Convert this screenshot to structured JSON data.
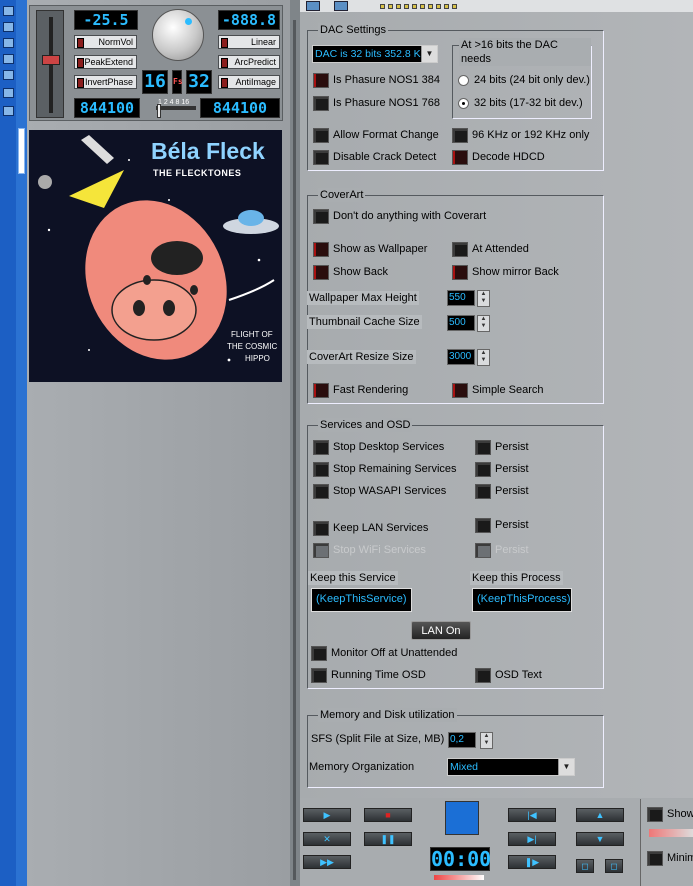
{
  "player": {
    "volume_display": "-25.5",
    "right_display": "-888.8",
    "norm_vol": "NormVol",
    "peak_extend": "PeakExtend",
    "invert_phase": "InvertPhase",
    "linear": "Linear",
    "arc_predict": "ArcPredict",
    "anti_image": "AntiImage",
    "bits_left": "16",
    "bits_right": "32",
    "fs_label": "Fs",
    "ticks": "1 2 4 8 16",
    "rate_left": "844100",
    "rate_right": "844100"
  },
  "cover": {
    "artist": "Béla Fleck",
    "band": "THE FLECKTONES",
    "album_line1": "FLIGHT OF",
    "album_line2": "THE COSMIC",
    "album_line3": "HIPPO"
  },
  "dac": {
    "title": "DAC Settings",
    "combo": "DAC is 32 bits 352.8 K",
    "phasure384": "Is Phasure NOS1 384",
    "phasure768": "Is Phasure NOS1 768",
    "needs_title": "At >16 bits the DAC needs",
    "radio24": "24 bits (24 bit only dev.)",
    "radio32": "32 bits (17-32 bit dev.)",
    "allow_format": "Allow Format Change",
    "khz_only": "96 KHz or 192 KHz only",
    "disable_crack": "Disable Crack Detect",
    "decode_hdcd": "Decode HDCD"
  },
  "coverart": {
    "title": "CoverArt",
    "dont": "Don't do anything with Coverart",
    "wallpaper": "Show as Wallpaper",
    "attended": "At Attended",
    "show_back": "Show Back",
    "mirror_back": "Show mirror Back",
    "max_height_label": "Wallpaper Max Height",
    "max_height": "550",
    "cache_label": "Thumbnail Cache Size",
    "cache": "500",
    "resize_label": "CoverArt Resize Size",
    "resize": "3000",
    "fast": "Fast Rendering",
    "simple": "Simple Search"
  },
  "services": {
    "title": "Services and OSD",
    "stop_desktop": "Stop Desktop Services",
    "stop_remaining": "Stop Remaining Services",
    "stop_wasapi": "Stop WASAPI Services",
    "persist": "Persist",
    "keep_lan": "Keep LAN Services",
    "stop_wifi": "Stop WiFi Services",
    "keep_service_label": "Keep this Service",
    "keep_process_label": "Keep this Process",
    "keep_service": "(KeepThisService)",
    "keep_process": "(KeepThisProcess)",
    "lan_on": "LAN On",
    "monitor_off": "Monitor Off at Unattended",
    "running_osd": "Running Time OSD",
    "osd_text": "OSD Text"
  },
  "memory": {
    "title": "Memory and Disk utilization",
    "sfs_label": "SFS (Split File at Size, MB)",
    "sfs": "0,2",
    "org_label": "Memory Organization",
    "org": "Mixed"
  },
  "transport": {
    "time": "00:00"
  },
  "right": {
    "show": "Show",
    "minim": "Minim"
  }
}
